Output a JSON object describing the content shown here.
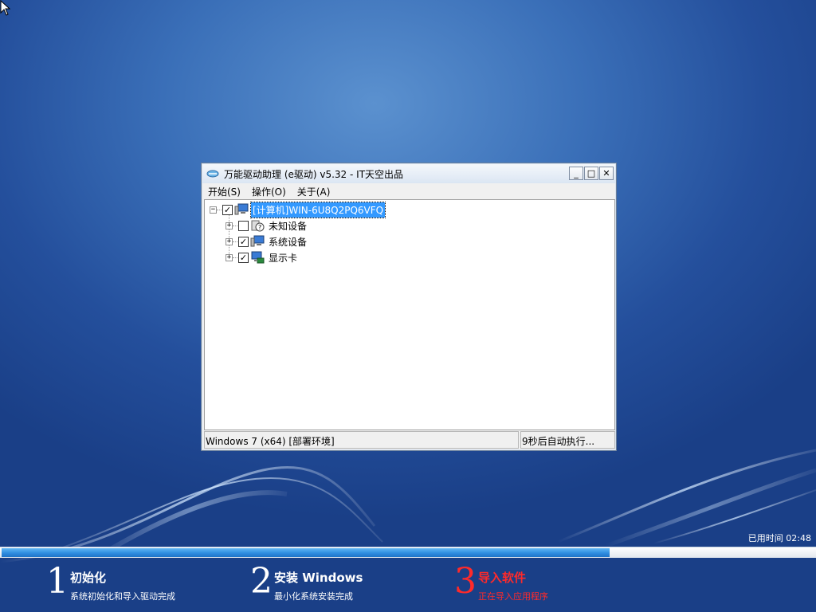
{
  "window": {
    "title": "万能驱动助理 (e驱动) v5.32 - IT天空出品",
    "controls": {
      "minimize": "_",
      "maximize": "□",
      "close": "✕"
    },
    "menu": [
      "开始(S)",
      "操作(O)",
      "关于(A)"
    ]
  },
  "tree": {
    "root": {
      "label": "[计算机]WIN-6U8Q2PQ6VFQ",
      "checked": true,
      "expander": "−"
    },
    "children": [
      {
        "label": "未知设备",
        "checked": false,
        "expander": "+",
        "icon": "unknown-device-icon"
      },
      {
        "label": "系统设备",
        "checked": true,
        "expander": "+",
        "icon": "system-device-icon"
      },
      {
        "label": "显示卡",
        "checked": true,
        "expander": "+",
        "icon": "display-card-icon"
      }
    ]
  },
  "status": {
    "left": "Windows 7 (x64) [部署环境]",
    "right": "9秒后自动执行..."
  },
  "elapsed": "已用时间 02:48",
  "progress": {
    "fraction": 0.748
  },
  "steps": [
    {
      "num": "1",
      "title": "初始化",
      "sub": "系统初始化和导入驱动完成",
      "active": false
    },
    {
      "num": "2",
      "title": "安装 Windows",
      "sub": "最小化系统安装完成",
      "active": false
    },
    {
      "num": "3",
      "title": "导入软件",
      "sub": "正在导入应用程序",
      "active": true
    }
  ],
  "colors": {
    "active_step": "#ff2a2a",
    "progress": "#2f8de0",
    "selection": "#3399ff"
  }
}
